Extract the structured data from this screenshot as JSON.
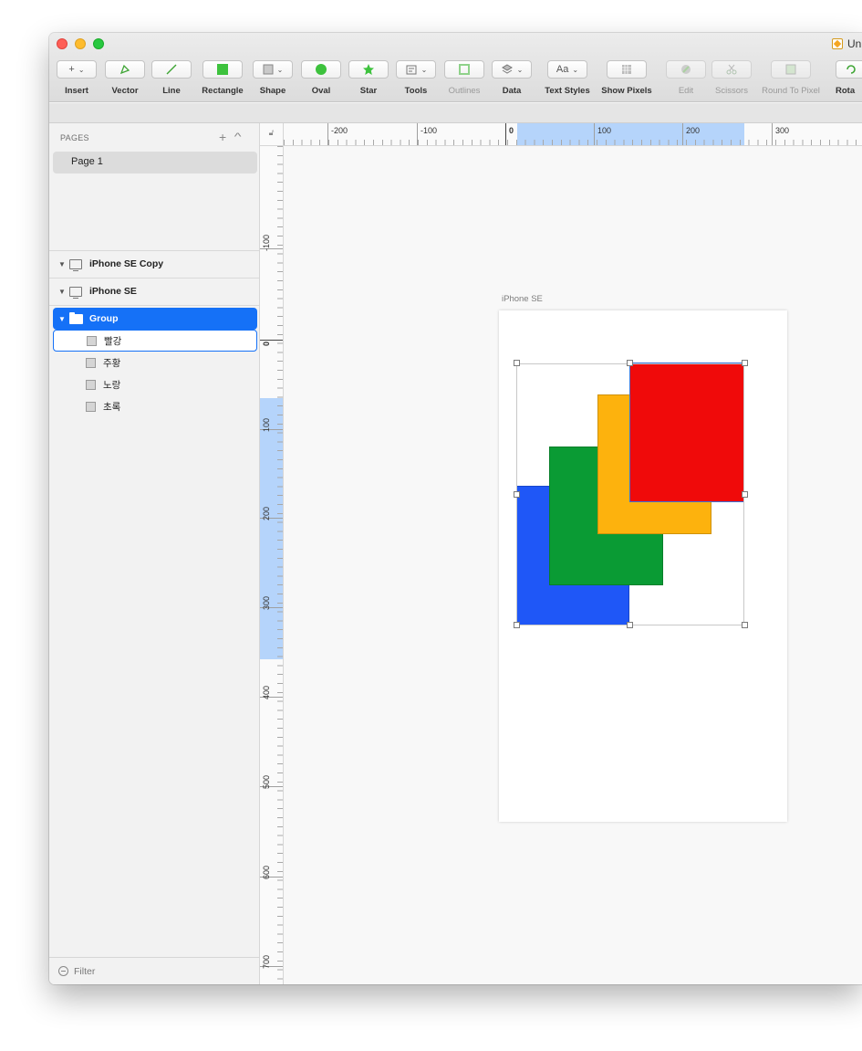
{
  "window": {
    "title": "Un",
    "controls": [
      "close",
      "minimize",
      "maximize"
    ]
  },
  "toolbar": {
    "items": [
      {
        "label": "Insert",
        "glyph": "+",
        "dropdown": true,
        "enabled": true
      },
      {
        "label": "Vector",
        "glyph": "pen",
        "dropdown": false,
        "enabled": true
      },
      {
        "label": "Line",
        "glyph": "line",
        "dropdown": false,
        "enabled": true
      },
      {
        "label": "Rectangle",
        "glyph": "rect",
        "dropdown": false,
        "enabled": true
      },
      {
        "label": "Shape",
        "glyph": "square",
        "dropdown": true,
        "enabled": true
      },
      {
        "label": "Oval",
        "glyph": "oval",
        "dropdown": false,
        "enabled": true
      },
      {
        "label": "Star",
        "glyph": "star",
        "dropdown": false,
        "enabled": true
      },
      {
        "label": "Tools",
        "glyph": "tools",
        "dropdown": true,
        "enabled": true
      },
      {
        "label": "Outlines",
        "glyph": "outlines",
        "dropdown": false,
        "enabled": false
      },
      {
        "label": "Data",
        "glyph": "layers",
        "dropdown": true,
        "enabled": true
      },
      {
        "label": "Text Styles",
        "glyph": "Aa",
        "dropdown": true,
        "enabled": true
      },
      {
        "label": "Show Pixels",
        "glyph": "grid",
        "dropdown": false,
        "enabled": true
      },
      {
        "label": "Edit",
        "glyph": "edit",
        "dropdown": false,
        "enabled": false
      },
      {
        "label": "Scissors",
        "glyph": "scissors",
        "dropdown": false,
        "enabled": false
      },
      {
        "label": "Round To Pixel",
        "glyph": "round",
        "dropdown": false,
        "enabled": false
      },
      {
        "label": "Rota",
        "glyph": "rotate",
        "dropdown": false,
        "enabled": true
      }
    ]
  },
  "sidebar": {
    "pages_header": "PAGES",
    "add_glyph": "+",
    "collapse_glyph": "^",
    "pages": [
      "Page 1"
    ],
    "artboards": [
      {
        "name": "iPhone SE Copy"
      },
      {
        "name": "iPhone SE"
      }
    ],
    "group": {
      "name": "Group"
    },
    "layers": [
      {
        "name": "빨강",
        "selected": true
      },
      {
        "name": "주황",
        "selected": false
      },
      {
        "name": "노랑",
        "selected": false
      },
      {
        "name": "초록",
        "selected": false
      }
    ],
    "filter_placeholder": "Filter"
  },
  "rulers": {
    "horizontal_labels": [
      "-200",
      "-100",
      "0",
      "100",
      "200",
      "300"
    ],
    "vertical_labels": [
      "-100",
      "0",
      "100",
      "200",
      "300",
      "400",
      "500",
      "600",
      "700"
    ],
    "highlight_color": "#b5d4fb"
  },
  "canvas": {
    "artboard_label": "iPhone SE",
    "shapes": [
      {
        "name": "blue-rectangle",
        "color": "#1f57f7"
      },
      {
        "name": "green-rectangle",
        "color": "#0a9b34"
      },
      {
        "name": "yellow-rectangle",
        "color": "#fdb20d"
      },
      {
        "name": "red-rectangle",
        "color": "#f00a0a"
      }
    ],
    "selection_color": "#3a72d6"
  }
}
